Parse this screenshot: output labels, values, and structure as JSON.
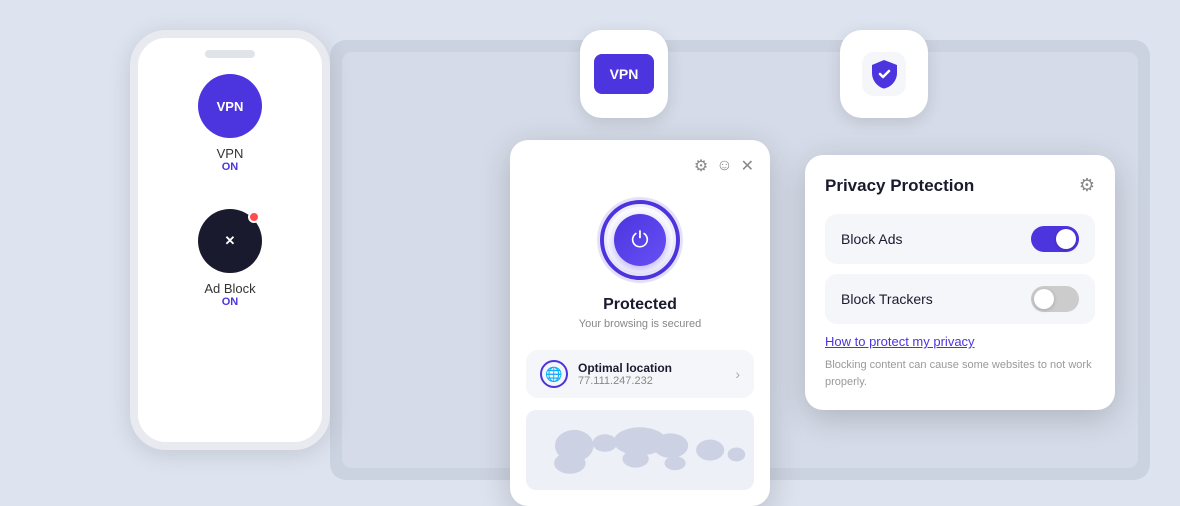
{
  "background": "#dde3ef",
  "phone": {
    "vpn_item": {
      "label": "VPN",
      "status": "ON",
      "icon_text": "VPN"
    },
    "adblock_item": {
      "label": "Ad Block",
      "status": "ON",
      "icon_text": "✕"
    }
  },
  "vpn_float": {
    "label": "VPN"
  },
  "shield_float": {},
  "vpn_panel": {
    "header_icons": [
      "⚙",
      "☺",
      "✕"
    ],
    "status": "Protected",
    "sub_status": "Your browsing is secured",
    "location_label": "Optimal location",
    "location_ip": "77.111.247.232"
  },
  "privacy_panel": {
    "title": "Privacy Protection",
    "block_ads_label": "Block Ads",
    "block_ads_on": true,
    "block_trackers_label": "Block Trackers",
    "block_trackers_on": false,
    "link_text": "How to protect my privacy",
    "note_text": "Blocking content can cause some websites to not work properly."
  }
}
